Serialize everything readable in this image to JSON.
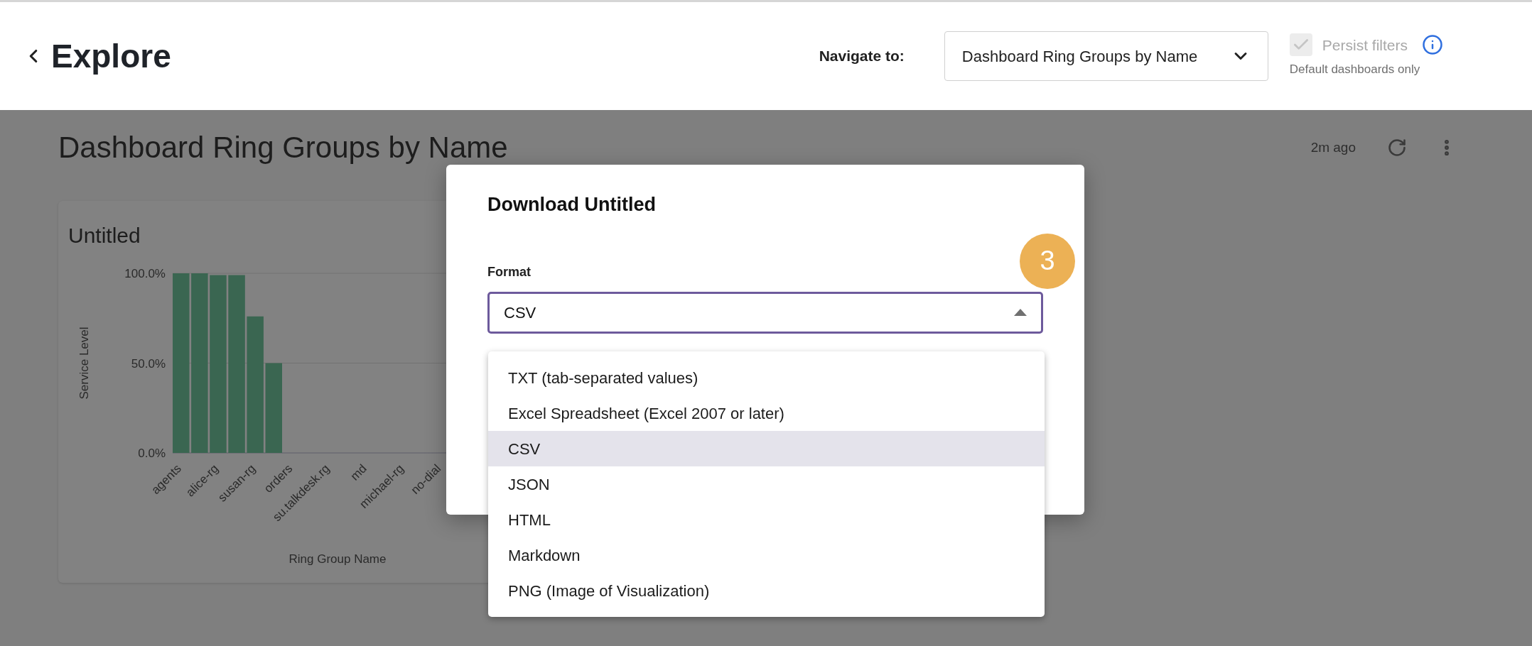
{
  "header": {
    "title": "Explore",
    "navigate_label": "Navigate to:",
    "navigate_value": "Dashboard Ring Groups by Name",
    "persist": {
      "label": "Persist filters",
      "checked": true,
      "disabled": true
    },
    "persist_note": "Default dashboards only"
  },
  "dashboard": {
    "title": "Dashboard Ring Groups by Name",
    "updated": "2m ago",
    "tile": {
      "title": "Untitled",
      "chart_data": {
        "type": "bar",
        "xlabel": "Ring Group Name",
        "ylabel": "Service Level",
        "categories": [
          "agents",
          null,
          "alice-rg",
          null,
          "susan-rg",
          null,
          "orders",
          null,
          "su.talkdesk.rg",
          null,
          "md",
          null,
          "michael-rg",
          null,
          "no-dial",
          null
        ],
        "series": [
          {
            "color": "#3a6651",
            "values": [
              1,
              1,
              0.99,
              0.99,
              0.76,
              0.5,
              null,
              null,
              null,
              null,
              null,
              null,
              null,
              null,
              null,
              null
            ]
          }
        ],
        "ylim": [
          0,
          1
        ],
        "yticks": [
          {
            "value": 0,
            "label": "0.0%"
          },
          {
            "value": 0.5,
            "label": "50.0%"
          },
          {
            "value": 1,
            "label": "100.0%"
          }
        ]
      }
    }
  },
  "dialog": {
    "title": "Download Untitled",
    "format_label": "Format",
    "format_value": "CSV",
    "expanded": true,
    "step_badge": "3",
    "options": [
      {
        "label": "TXT (tab-separated values)",
        "selected": false
      },
      {
        "label": "Excel Spreadsheet (Excel 2007 or later)",
        "selected": false
      },
      {
        "label": "CSV",
        "selected": true
      },
      {
        "label": "JSON",
        "selected": false
      },
      {
        "label": "HTML",
        "selected": false
      },
      {
        "label": "Markdown",
        "selected": false
      },
      {
        "label": "PNG (Image of Visualization)",
        "selected": false
      }
    ]
  }
}
